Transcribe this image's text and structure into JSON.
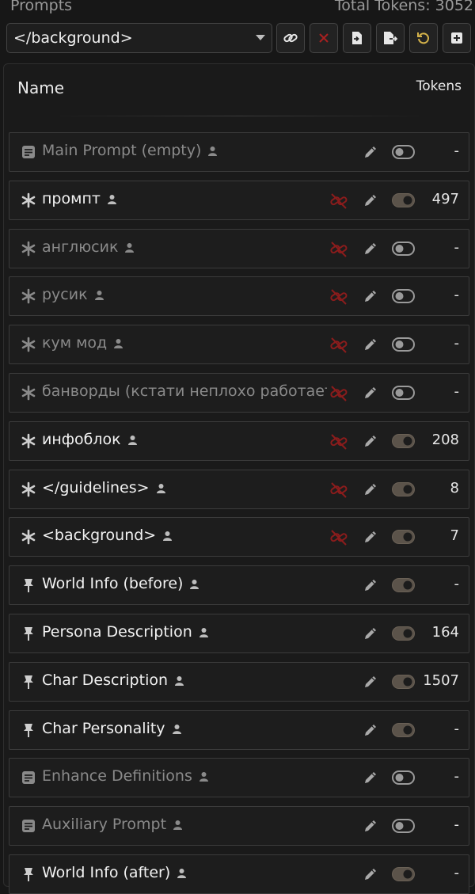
{
  "header": {
    "title": "Prompts",
    "total_tokens": "Total Tokens: 3052"
  },
  "select": {
    "value": "</background>"
  },
  "columns": {
    "name": "Name",
    "tokens": "Tokens"
  },
  "colors": {
    "background": "#171717",
    "unlink_red": "#8b1c1c",
    "reset_yellow": "#d4b24a",
    "delete_red": "#a82020"
  },
  "toolbar": [
    {
      "icon": "link-icon"
    },
    {
      "icon": "close-icon"
    },
    {
      "icon": "import-file-icon"
    },
    {
      "icon": "export-file-icon"
    },
    {
      "icon": "reset-icon"
    },
    {
      "icon": "add-icon"
    }
  ],
  "rows": [
    {
      "name": "Main Prompt (empty)",
      "icon": "document-icon",
      "enabled": false,
      "unlink": false,
      "tokens": "-"
    },
    {
      "name": "промпт",
      "icon": "asterisk-icon",
      "enabled": true,
      "unlink": true,
      "tokens": "497"
    },
    {
      "name": "англюсик",
      "icon": "asterisk-icon",
      "enabled": false,
      "unlink": true,
      "tokens": "-"
    },
    {
      "name": "русик",
      "icon": "asterisk-icon",
      "enabled": false,
      "unlink": true,
      "tokens": "-"
    },
    {
      "name": "кум мод",
      "icon": "asterisk-icon",
      "enabled": false,
      "unlink": true,
      "tokens": "-"
    },
    {
      "name": "банворды (кстати неплохо работает",
      "icon": "asterisk-icon",
      "enabled": false,
      "unlink": true,
      "tokens": "-"
    },
    {
      "name": "инфоблок",
      "icon": "asterisk-icon",
      "enabled": true,
      "unlink": true,
      "tokens": "208"
    },
    {
      "name": "</guidelines>",
      "icon": "asterisk-icon",
      "enabled": true,
      "unlink": true,
      "tokens": "8"
    },
    {
      "name": "<background>",
      "icon": "asterisk-icon",
      "enabled": true,
      "unlink": true,
      "tokens": "7"
    },
    {
      "name": "World Info (before)",
      "icon": "pin-icon",
      "enabled": true,
      "unlink": false,
      "tokens": "-"
    },
    {
      "name": "Persona Description",
      "icon": "pin-icon",
      "enabled": true,
      "unlink": false,
      "tokens": "164"
    },
    {
      "name": "Char Description",
      "icon": "pin-icon",
      "enabled": true,
      "unlink": false,
      "tokens": "1507"
    },
    {
      "name": "Char Personality",
      "icon": "pin-icon",
      "enabled": true,
      "unlink": false,
      "tokens": "-"
    },
    {
      "name": "Enhance Definitions",
      "icon": "document-icon",
      "enabled": false,
      "unlink": false,
      "tokens": "-"
    },
    {
      "name": "Auxiliary Prompt",
      "icon": "document-icon",
      "enabled": false,
      "unlink": false,
      "tokens": "-"
    },
    {
      "name": "World Info (after)",
      "icon": "pin-icon",
      "enabled": true,
      "unlink": false,
      "tokens": "-"
    }
  ]
}
